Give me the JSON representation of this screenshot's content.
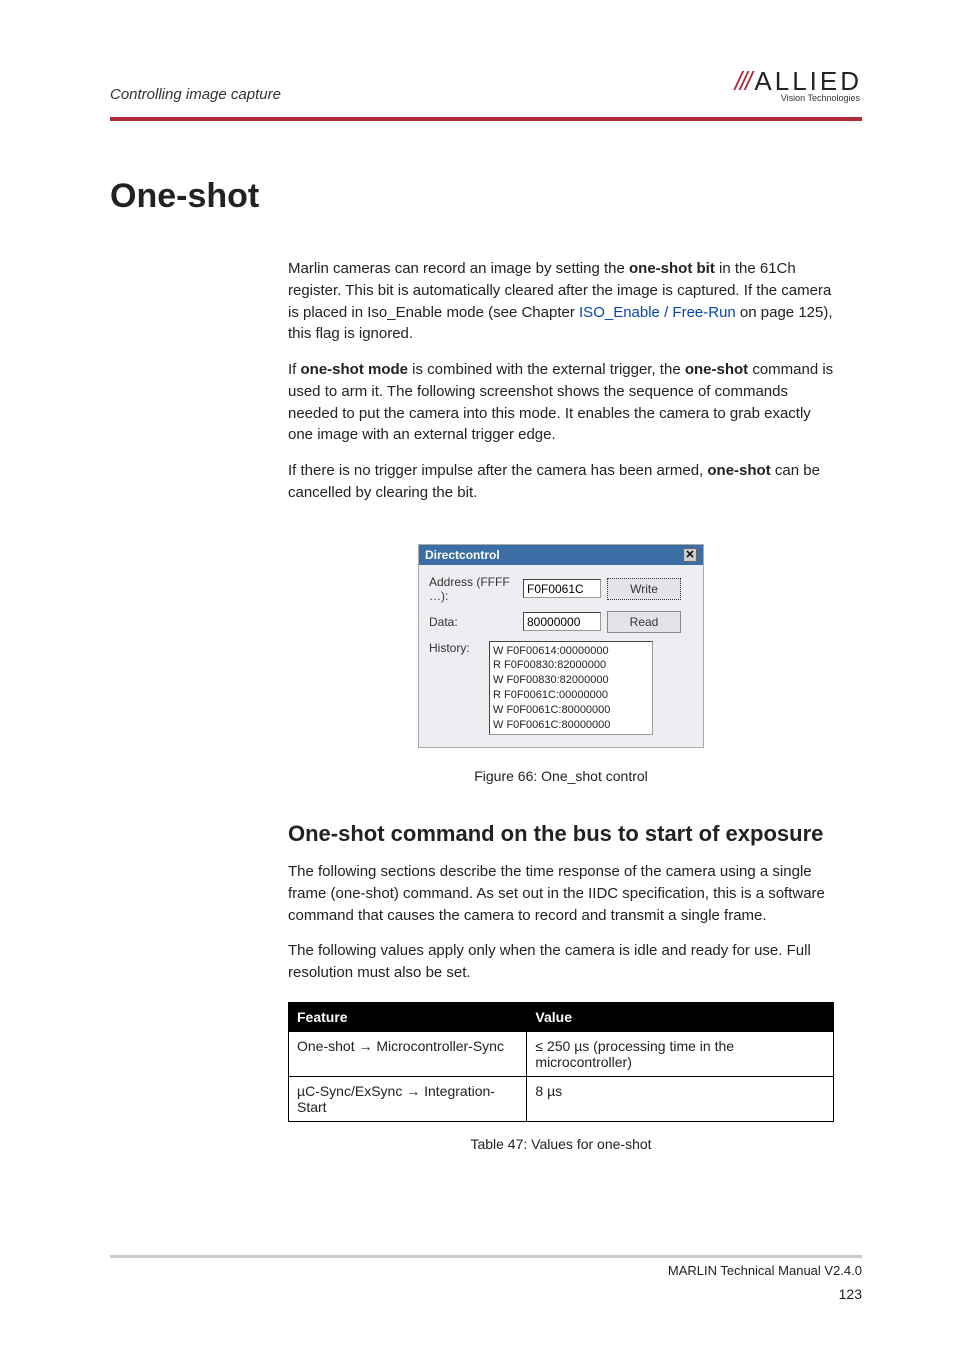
{
  "header": {
    "section": "Controlling image capture",
    "logo_slashes": "///",
    "logo_text": "ALLIED",
    "logo_sub": "Vision Technologies"
  },
  "h1": "One-shot",
  "para1_html": "Marlin cameras can record an image by setting the <b>one-shot bit</b> in the 61Ch register. This bit is automatically cleared after the image is captured. If the camera is placed in Iso_Enable mode (see Chapter <span class=\"link\">ISO_Enable / Free-Run</span> on page 125), this flag is ignored.",
  "para2_html": "If <b>one-shot mode</b> is combined with the external trigger, the <b>one-shot</b> command is used to arm it. The following screenshot shows the sequence of commands needed to put the camera into this mode. It enables the camera to grab exactly one image with an external trigger edge.",
  "para3_html": "If there is no trigger impulse after the camera has been armed, <b>one-shot</b> can be cancelled by clearing the bit.",
  "screenshot": {
    "window_title": "Directcontrol",
    "close_glyph": "✕",
    "addr_label": "Address (FFFF …):",
    "addr_value": "F0F0061C",
    "data_label": "Data:",
    "data_value": "80000000",
    "write_label": "Write",
    "read_label": "Read",
    "hist_label": "History:",
    "hist_lines": "W F0F00614:00000000\nR F0F00830:82000000\nW F0F00830:82000000\nR F0F0061C:00000000\nW F0F0061C:80000000\nW F0F0061C:80000000"
  },
  "fig_caption": "Figure 66: One_shot control",
  "h2": "One-shot command on the bus to start of exposure",
  "para4": "The following sections describe the time response of the camera using a single frame (one-shot) command. As set out in the IIDC specification, this is a software command that causes the camera to record and transmit a single frame.",
  "para5": "The following values apply only when the camera is idle and ready for use. Full resolution must also be set.",
  "table": {
    "headers": [
      "Feature",
      "Value"
    ],
    "rows": [
      {
        "feature_html": "One-shot <span class=\"arrow\">→</span> Microcontroller-Sync",
        "value_html": "≤ 250 µs (processing time in the microcontroller)"
      },
      {
        "feature_html": "µC-Sync/ExSync <span class=\"arrow\">→</span> Integration-Start",
        "value_html": "8 µs"
      }
    ]
  },
  "table_caption": "Table 47: Values for one-shot",
  "footer": {
    "doc": "MARLIN Technical Manual V2.4.0",
    "page": "123"
  }
}
